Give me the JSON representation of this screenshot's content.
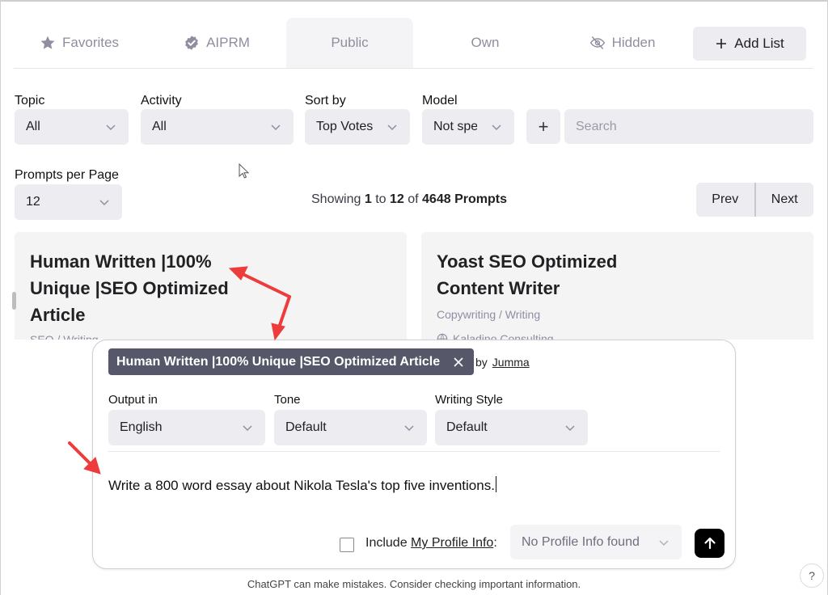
{
  "tabs": [
    {
      "label": "Favorites",
      "icon": "star-icon",
      "active": false
    },
    {
      "label": "AIPRM",
      "icon": "verified-badge-icon",
      "active": false
    },
    {
      "label": "Public",
      "icon": null,
      "active": true
    },
    {
      "label": "Own",
      "icon": null,
      "active": false
    },
    {
      "label": "Hidden",
      "icon": "eye-off-icon",
      "active": false
    }
  ],
  "add_list": {
    "label": "Add List",
    "icon": "plus-icon"
  },
  "filters": {
    "topic": {
      "label": "Topic",
      "value": "All"
    },
    "activity": {
      "label": "Activity",
      "value": "All"
    },
    "sort_by": {
      "label": "Sort by",
      "value": "Top Votes"
    },
    "model": {
      "label": "Model",
      "value": "Not specified"
    },
    "add_button": "+",
    "search": {
      "placeholder": "Search",
      "value": ""
    }
  },
  "prompts_per_page": {
    "label": "Prompts per Page",
    "value": "12"
  },
  "showing": {
    "prefix": "Showing",
    "from": "1",
    "to_word": "to",
    "to": "12",
    "of_word": "of",
    "total": "4648 Prompts"
  },
  "pager": {
    "prev": "Prev",
    "next": "Next"
  },
  "cards": [
    {
      "title_lines": [
        "Human Written |100%",
        "Unique |SEO Optimized",
        "Article"
      ],
      "category": "SEO / Writing"
    },
    {
      "title_lines": [
        "Yoast SEO Optimized",
        "Content Writer"
      ],
      "category": "Copywriting / Writing",
      "author": "Kaladino Consulting"
    }
  ],
  "composer": {
    "selected_prompt": "Human Written |100% Unique |SEO Optimized Article",
    "by_label": "by",
    "author": "Jumma",
    "output_in": {
      "label": "Output in",
      "value": "English"
    },
    "tone": {
      "label": "Tone",
      "value": "Default"
    },
    "writing_style": {
      "label": "Writing Style",
      "value": "Default"
    },
    "prompt_text": "Write a 800 word essay about Nikola Tesla's top five inventions.",
    "include_label": "Include",
    "profile_link": "My Profile Info",
    "colon": ":",
    "include_checked": false,
    "profile_select": "No Profile Info found"
  },
  "disclaimer": "ChatGPT can make mistakes. Consider checking important information.",
  "help": "?",
  "colors": {
    "chip_bg": "#565869",
    "control_bg": "#ececf1",
    "annotation_arrow": "#ee3b3b",
    "send_bg": "#000000"
  }
}
